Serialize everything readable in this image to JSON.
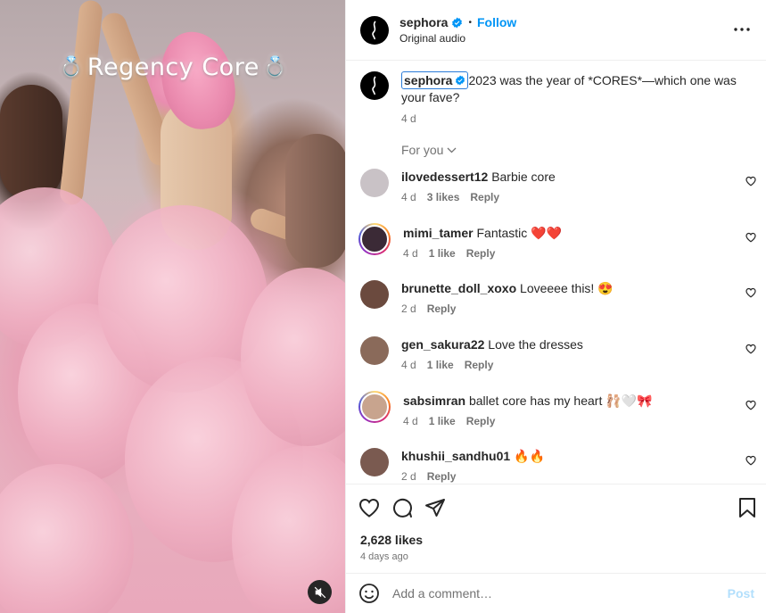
{
  "media": {
    "overlay_title": "Regency Core",
    "ring_glyph": "💍",
    "mute_icon": "speaker-muted-icon"
  },
  "header": {
    "username": "sephora",
    "separator": "•",
    "follow_label": "Follow",
    "audio": "Original audio"
  },
  "caption": {
    "username": "sephora",
    "text": "2023 was the year of *CORES*—which one was your fave?",
    "age": "4 d"
  },
  "for_you": "For you",
  "comments": [
    {
      "user": "ilovedessert12",
      "text": "Barbie core",
      "age": "4 d",
      "likes": "3 likes",
      "reply": "Reply",
      "avatar_color": "#c9c2c6",
      "story_ring": false
    },
    {
      "user": "mimi_tamer",
      "text": "Fantastic ❤️❤️",
      "age": "4 d",
      "likes": "1 like",
      "reply": "Reply",
      "avatar_color": "#3b2a36",
      "story_ring": true
    },
    {
      "user": "brunette_doll_xoxo",
      "text": "Loveeee this! 😍",
      "age": "2 d",
      "likes": "",
      "reply": "Reply",
      "avatar_color": "#6b4a3e",
      "story_ring": false
    },
    {
      "user": "gen_sakura22",
      "text": "Love the dresses",
      "age": "4 d",
      "likes": "1 like",
      "reply": "Reply",
      "avatar_color": "#8a6a5a",
      "story_ring": false
    },
    {
      "user": "sabsimran",
      "text": "ballet core has my heart 🩰🤍🎀",
      "age": "4 d",
      "likes": "1 like",
      "reply": "Reply",
      "avatar_color": "#c8a48e",
      "story_ring": true
    },
    {
      "user": "khushii_sandhu01",
      "text": "🔥🔥",
      "age": "2 d",
      "likes": "",
      "reply": "Reply",
      "avatar_color": "#7a5a50",
      "story_ring": false
    }
  ],
  "stats": {
    "likes": "2,628 likes",
    "posted": "4 days ago"
  },
  "composer": {
    "placeholder": "Add a comment…",
    "post_label": "Post"
  },
  "colors": {
    "accent": "#0095f6",
    "muted": "#737373",
    "verified": "#0095f6",
    "post_disabled": "#b2dffc"
  }
}
